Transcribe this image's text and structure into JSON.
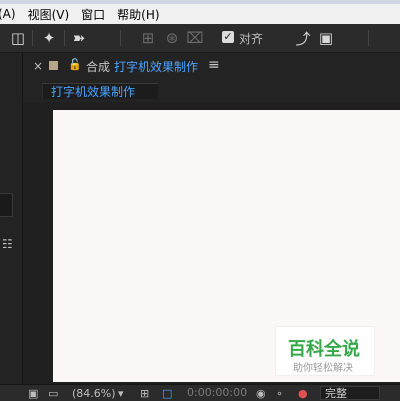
{
  "menu": [
    "(A)",
    "视图(V)",
    "窗口",
    "帮助(H)"
  ],
  "toolbar": {
    "snap_label": "对齐",
    "icons": [
      "eraser-icon",
      "puppet-pin-icon",
      "pin-icon",
      "axis-icon",
      "scale-icon",
      "expand-icon",
      "curve-icon",
      "target-icon"
    ]
  },
  "composition": {
    "panel_label": "合成",
    "name": "打字机效果制作",
    "tab_label": "打字机效果制作"
  },
  "watermark": {
    "title": "百科全说",
    "subtitle": "助你轻松解决"
  },
  "status": {
    "zoom": "(84.6%)",
    "timecode": "0:00:00:00",
    "quality": "完整"
  },
  "colors": {
    "accent": "#4ba3ff",
    "canvas": "#fbf7f7",
    "watermark_green": "#36a84a"
  }
}
